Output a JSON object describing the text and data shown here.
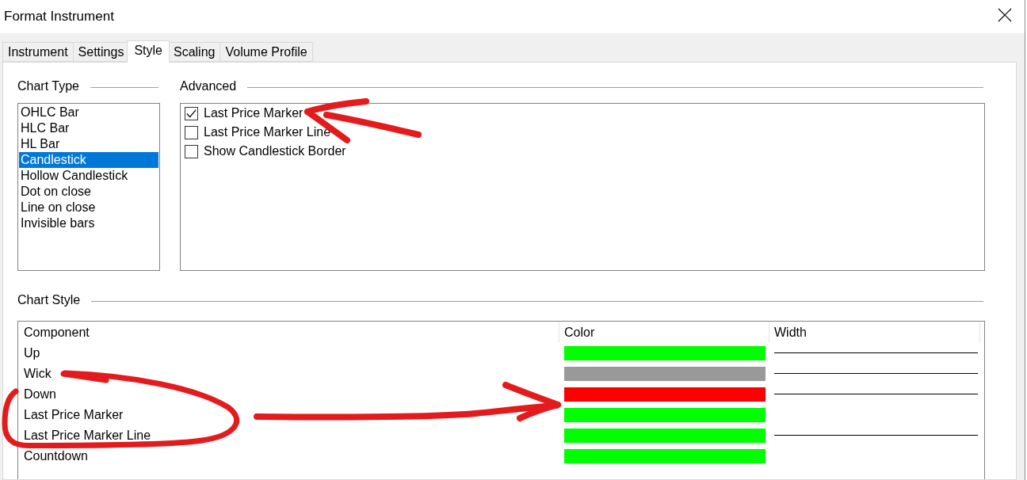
{
  "window": {
    "title": "Format Instrument"
  },
  "tabs": [
    {
      "label": "Instrument",
      "selected": false
    },
    {
      "label": "Settings",
      "selected": false
    },
    {
      "label": "Style",
      "selected": true
    },
    {
      "label": "Scaling",
      "selected": false
    },
    {
      "label": "Volume Profile",
      "selected": false
    }
  ],
  "chart_type": {
    "title": "Chart Type",
    "items": [
      {
        "label": "OHLC Bar",
        "selected": false
      },
      {
        "label": "HLC Bar",
        "selected": false
      },
      {
        "label": "HL Bar",
        "selected": false
      },
      {
        "label": "Candlestick",
        "selected": true
      },
      {
        "label": "Hollow Candlestick",
        "selected": false
      },
      {
        "label": "Dot on close",
        "selected": false
      },
      {
        "label": "Line on close",
        "selected": false
      },
      {
        "label": "Invisible bars",
        "selected": false
      }
    ]
  },
  "advanced": {
    "title": "Advanced",
    "options": [
      {
        "label": "Last Price Marker",
        "checked": true
      },
      {
        "label": "Last Price Marker Line",
        "checked": false
      },
      {
        "label": "Show Candlestick Border",
        "checked": false
      }
    ]
  },
  "chart_style": {
    "title": "Chart Style",
    "columns": [
      "Component",
      "Color",
      "Width"
    ],
    "rows": [
      {
        "component": "Up",
        "color": "#00ff00",
        "width_line": true
      },
      {
        "component": "Wick",
        "color": "#999999",
        "width_line": true
      },
      {
        "component": "Down",
        "color": "#ff0000",
        "width_line": true
      },
      {
        "component": "Last Price Marker",
        "color": "#00ff00",
        "width_line": false
      },
      {
        "component": "Last Price Marker Line",
        "color": "#00ff00",
        "width_line": true
      },
      {
        "component": "Countdown",
        "color": "#00ff00",
        "width_line": false
      }
    ]
  }
}
